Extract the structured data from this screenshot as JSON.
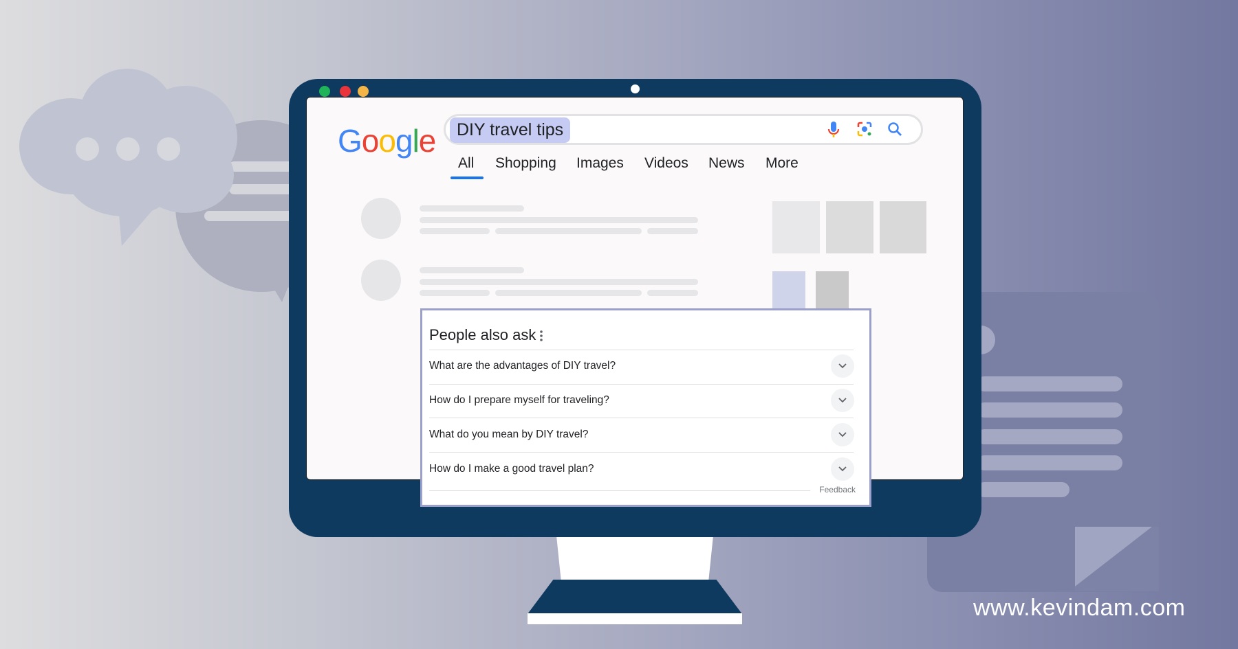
{
  "search": {
    "query": "DIY travel tips"
  },
  "tabs": [
    {
      "label": "All",
      "active": true
    },
    {
      "label": "Shopping"
    },
    {
      "label": "Images"
    },
    {
      "label": "Videos"
    },
    {
      "label": "News"
    },
    {
      "label": "More"
    }
  ],
  "paa": {
    "title": "People also ask",
    "questions": [
      "What are the advantages of DIY travel?",
      "How do I prepare myself for traveling?",
      "What do you mean by DIY travel?",
      "How do I make a good travel plan?"
    ],
    "feedback": "Feedback"
  },
  "watermark": "www.kevindam.com",
  "logo": "Google",
  "colors": {
    "monitor": "#0d3a5e",
    "accent": "#1a73e8",
    "query_highlight": "#c6cbf3",
    "paa_border": "#9aa0ca"
  },
  "icons": [
    "mic-icon",
    "lens-icon",
    "search-icon",
    "more-vert-icon",
    "chevron-down-icon"
  ]
}
